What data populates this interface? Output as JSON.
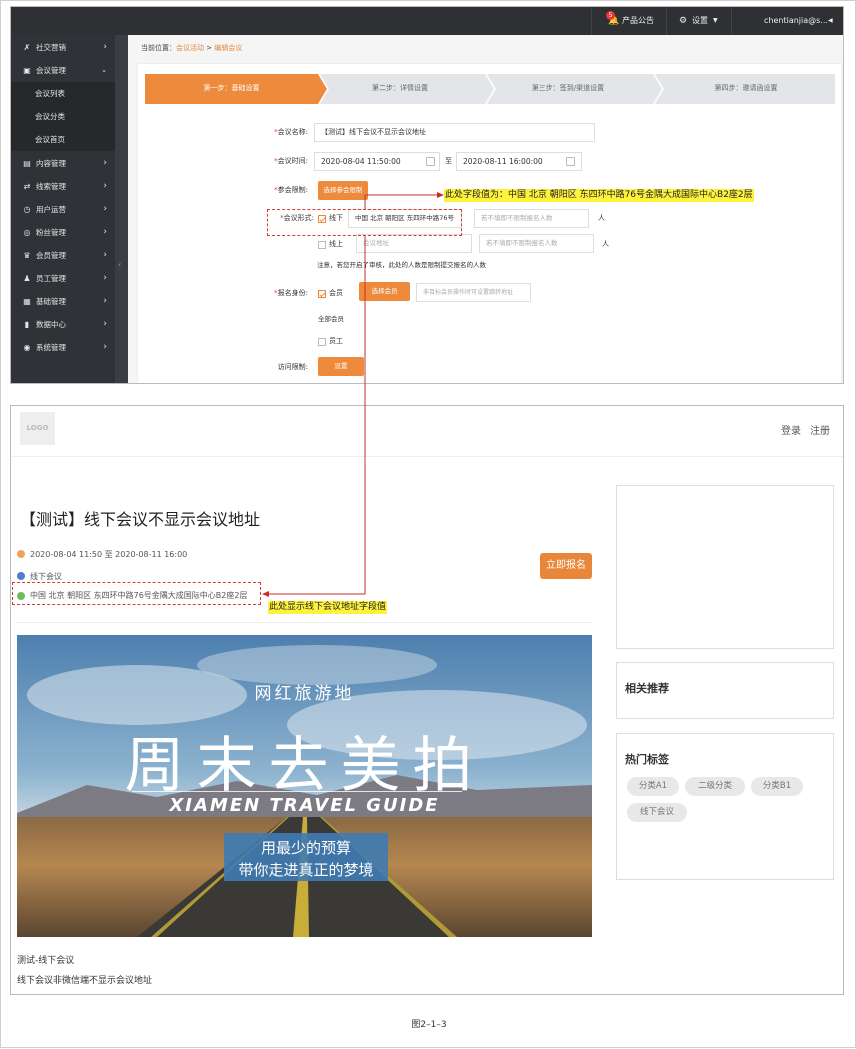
{
  "admin": {
    "topbar": {
      "badge": "5",
      "announcement": "产品公告",
      "settings": "设置",
      "user": "chentianjia@s..."
    },
    "sidebar": {
      "items": [
        {
          "label": "社交营销",
          "icon": "share-icon"
        },
        {
          "label": "会议管理",
          "icon": "meeting-icon"
        },
        {
          "label": "内容管理",
          "icon": "document-icon"
        },
        {
          "label": "线索管理",
          "icon": "lead-icon"
        },
        {
          "label": "用户运营",
          "icon": "clock-icon"
        },
        {
          "label": "粉丝管理",
          "icon": "fan-icon"
        },
        {
          "label": "会员管理",
          "icon": "crown-icon"
        },
        {
          "label": "员工管理",
          "icon": "person-icon"
        },
        {
          "label": "基础管理",
          "icon": "box-icon"
        },
        {
          "label": "数据中心",
          "icon": "bar-chart-icon"
        },
        {
          "label": "系统管理",
          "icon": "system-icon"
        }
      ],
      "subitems": [
        "会议列表",
        "会议分类",
        "会议首页"
      ]
    },
    "breadcrumb": {
      "prefix": "当前位置：",
      "parent": "会议活动",
      "separator": ">",
      "current": "编辑会议"
    },
    "steps": [
      "第一步：基础设置",
      "第二步：详情设置",
      "第三步：签到/渠道设置",
      "第四步：邀请函设置"
    ],
    "form": {
      "name_label": "会议名称:",
      "name_value": "【测试】线下会议不显示会议地址",
      "time_label": "会议时间:",
      "time_start": "2020-08-04 11:50:00",
      "time_to": "至",
      "time_end": "2020-08-11 16:00:00",
      "limit_label": "参会限制:",
      "limit_button": "选择参会限制",
      "format_label": "会议形式:",
      "offline_label": "线下",
      "offline_address": "中国 北京 朝阳区 东四环中路76号",
      "offline_count_placeholder": "若不填即不限制报名人数",
      "person_unit": "人",
      "online_label": "线上",
      "online_address_placeholder": "会议地址",
      "online_count_placeholder": "若不填即不限制报名人数",
      "note": "注意，若您开启了审核，此处的人数是限制提交报名的人数",
      "identity_label": "报名身份:",
      "member_label": "会员",
      "select_member_button": "选择会员",
      "member_jump_placeholder": "非目标会员操作时可设置跳转地址",
      "all_members": "全部会员",
      "staff_label": "员工",
      "access_label": "访问限制:",
      "access_button": "设置"
    },
    "annotation": "此处字段值为：中国 北京 朝阳区 东四环中路76号金隅大成国际中心B2座2层"
  },
  "front": {
    "logo": "LOGO",
    "login": "登录",
    "register": "注册",
    "title": "【测试】线下会议不显示会议地址",
    "time": "2020-08-04 11:50 至 2020-08-11 16:00",
    "format": "线下会议",
    "address": "中国 北京 朝阳区 东四环中路76号金隅大成国际中心B2座2层",
    "address_annotation": "此处显示线下会议地址字段值",
    "register_button": "立即报名",
    "banner": {
      "small_title": "网红旅游地",
      "big_title": "周末去美拍",
      "english": "XIAMEN  TRAVEL  GUIDE",
      "sub1": "用最少的预算",
      "sub2": "带你走进真正的梦境"
    },
    "desc1": "测试-线下会议",
    "desc2": "线下会议非微信端不显示会议地址",
    "related_title": "相关推荐",
    "tags_title": "热门标签",
    "tags": [
      "分类A1",
      "二级分类",
      "分类B1",
      "线下会议"
    ]
  },
  "caption": "图2–1–3"
}
